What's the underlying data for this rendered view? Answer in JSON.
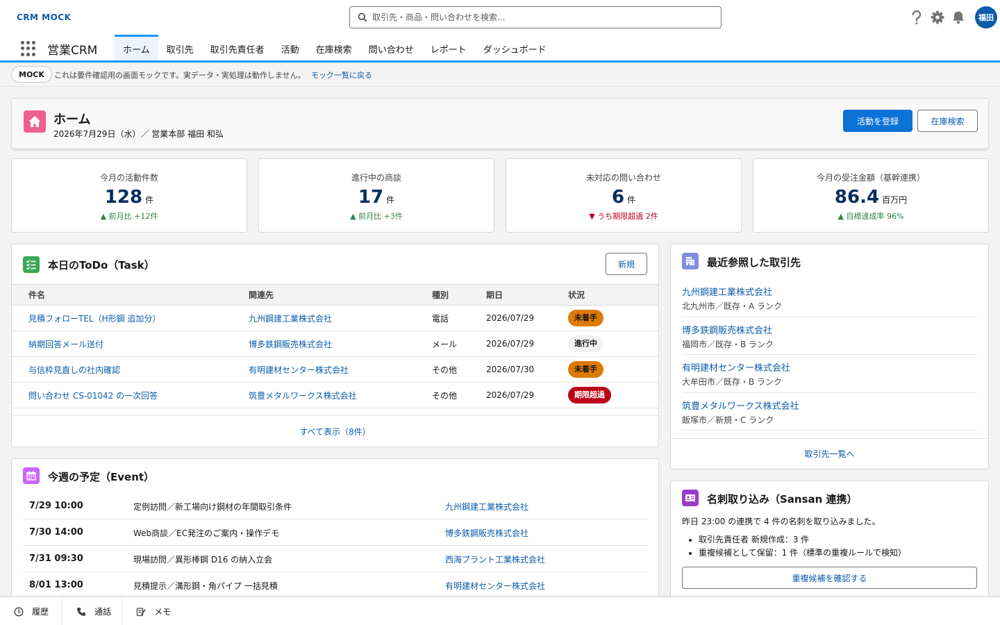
{
  "header": {
    "brand": "CRM MOCK",
    "search_placeholder": "取引先・商品・問い合わせを検索...",
    "user_initials": "福田"
  },
  "nav": {
    "app_name": "営業CRM",
    "tabs": [
      "ホーム",
      "取引先",
      "取引先責任者",
      "活動",
      "在庫検索",
      "問い合わせ",
      "レポート",
      "ダッシュボード"
    ],
    "active_tab": "ホーム"
  },
  "mock_banner": {
    "badge": "MOCK",
    "text": "これは要件確認用の画面モックです。実データ・実処理は動作しません。",
    "link": "モック一覧に戻る"
  },
  "page_header": {
    "title": "ホーム",
    "subtitle": "2026年7月29日（水）／ 営業本部 福田 和弘",
    "btn_log_activity": "活動を登録",
    "btn_stock_search": "在庫検索"
  },
  "kpis": [
    {
      "label": "今月の活動件数",
      "value": "128",
      "unit": "件",
      "delta_arrow": "▲",
      "delta": "前月比 +12件",
      "trend": "up"
    },
    {
      "label": "進行中の商談",
      "value": "17",
      "unit": "件",
      "delta_arrow": "▲",
      "delta": "前月比 +3件",
      "trend": "up"
    },
    {
      "label": "未対応の問い合わせ",
      "value": "6",
      "unit": "件",
      "delta_arrow": "▼",
      "delta": "うち期限超過 2件",
      "trend": "down"
    },
    {
      "label": "今月の受注金額（基幹連携）",
      "value": "86.4",
      "unit": "百万円",
      "delta_arrow": "▲",
      "delta": "目標達成率 96%",
      "trend": "up"
    }
  ],
  "todo": {
    "title": "本日のToDo（Task）",
    "new_button": "新規",
    "columns": [
      "件名",
      "関連先",
      "種別",
      "期日",
      "状況"
    ],
    "rows": [
      {
        "subject": "見積フォローTEL（H形鋼 追加分）",
        "related": "九州鋼建工業株式会社",
        "type": "電話",
        "due": "2026/07/29",
        "status": "未着手",
        "status_kind": "orange"
      },
      {
        "subject": "納期回答メール送付",
        "related": "博多鉄鋼販売株式会社",
        "type": "メール",
        "due": "2026/07/29",
        "status": "進行中",
        "status_kind": "gray"
      },
      {
        "subject": "与信枠見直しの社内確認",
        "related": "有明建材センター株式会社",
        "type": "その他",
        "due": "2026/07/30",
        "status": "未着手",
        "status_kind": "orange"
      },
      {
        "subject": "問い合わせ CS-01042 の一次回答",
        "related": "筑豊メタルワークス株式会社",
        "type": "その他",
        "due": "2026/07/29",
        "status": "期限超過",
        "status_kind": "red"
      }
    ],
    "view_all": "すべて表示（8件）"
  },
  "recent_accounts": {
    "title": "最近参照した取引先",
    "items": [
      {
        "name": "九州鋼建工業株式会社",
        "sub": "北九州市／既存・A ランク"
      },
      {
        "name": "博多鉄鋼販売株式会社",
        "sub": "福岡市／既存・B ランク"
      },
      {
        "name": "有明建材センター株式会社",
        "sub": "大牟田市／既存・B ランク"
      },
      {
        "name": "筑豊メタルワークス株式会社",
        "sub": "飯塚市／新規・C ランク"
      }
    ],
    "footer_link": "取引先一覧へ"
  },
  "events": {
    "title": "今週の予定（Event）",
    "rows": [
      {
        "time": "7/29 10:00",
        "subject": "定例訪問／新工場向け鋼材の年間取引条件",
        "account": "九州鋼建工業株式会社"
      },
      {
        "time": "7/30 14:00",
        "subject": "Web商談／EC発注のご案内・操作デモ",
        "account": "博多鉄鋼販売株式会社"
      },
      {
        "time": "7/31 09:30",
        "subject": "現場訪問／異形棒鋼 D16 の納入立会",
        "account": "西海プラント工業株式会社"
      },
      {
        "time": "8/01 13:00",
        "subject": "見積提示／溝形鋼・角パイプ 一括見積",
        "account": "有明建材センター株式会社"
      }
    ]
  },
  "sansan": {
    "title": "名刺取り込み（Sansan 連携）",
    "text": "昨日 23:00 の連携で 4 件の名刺を取り込みました。",
    "bullets": [
      "取引先責任者 新規作成：3 件",
      "重複候補として保留：1 件（標準の重複ルールで検知）"
    ],
    "button": "重複候補を確認する"
  },
  "utility_bar": {
    "items": [
      "履歴",
      "通話",
      "メモ"
    ]
  },
  "colors": {
    "brand": "#0b5cab",
    "nav_accent": "#1b96ff",
    "home_icon": "#f15e92",
    "todo_icon": "#3ba755",
    "recent_icon": "#7f8de1",
    "event_icon": "#cb65ff",
    "sansan_icon": "#9c39c6",
    "status_orange": "#dd7a01",
    "status_red": "#ba0517",
    "trend_up": "#2e844a",
    "trend_down": "#ba0517"
  }
}
